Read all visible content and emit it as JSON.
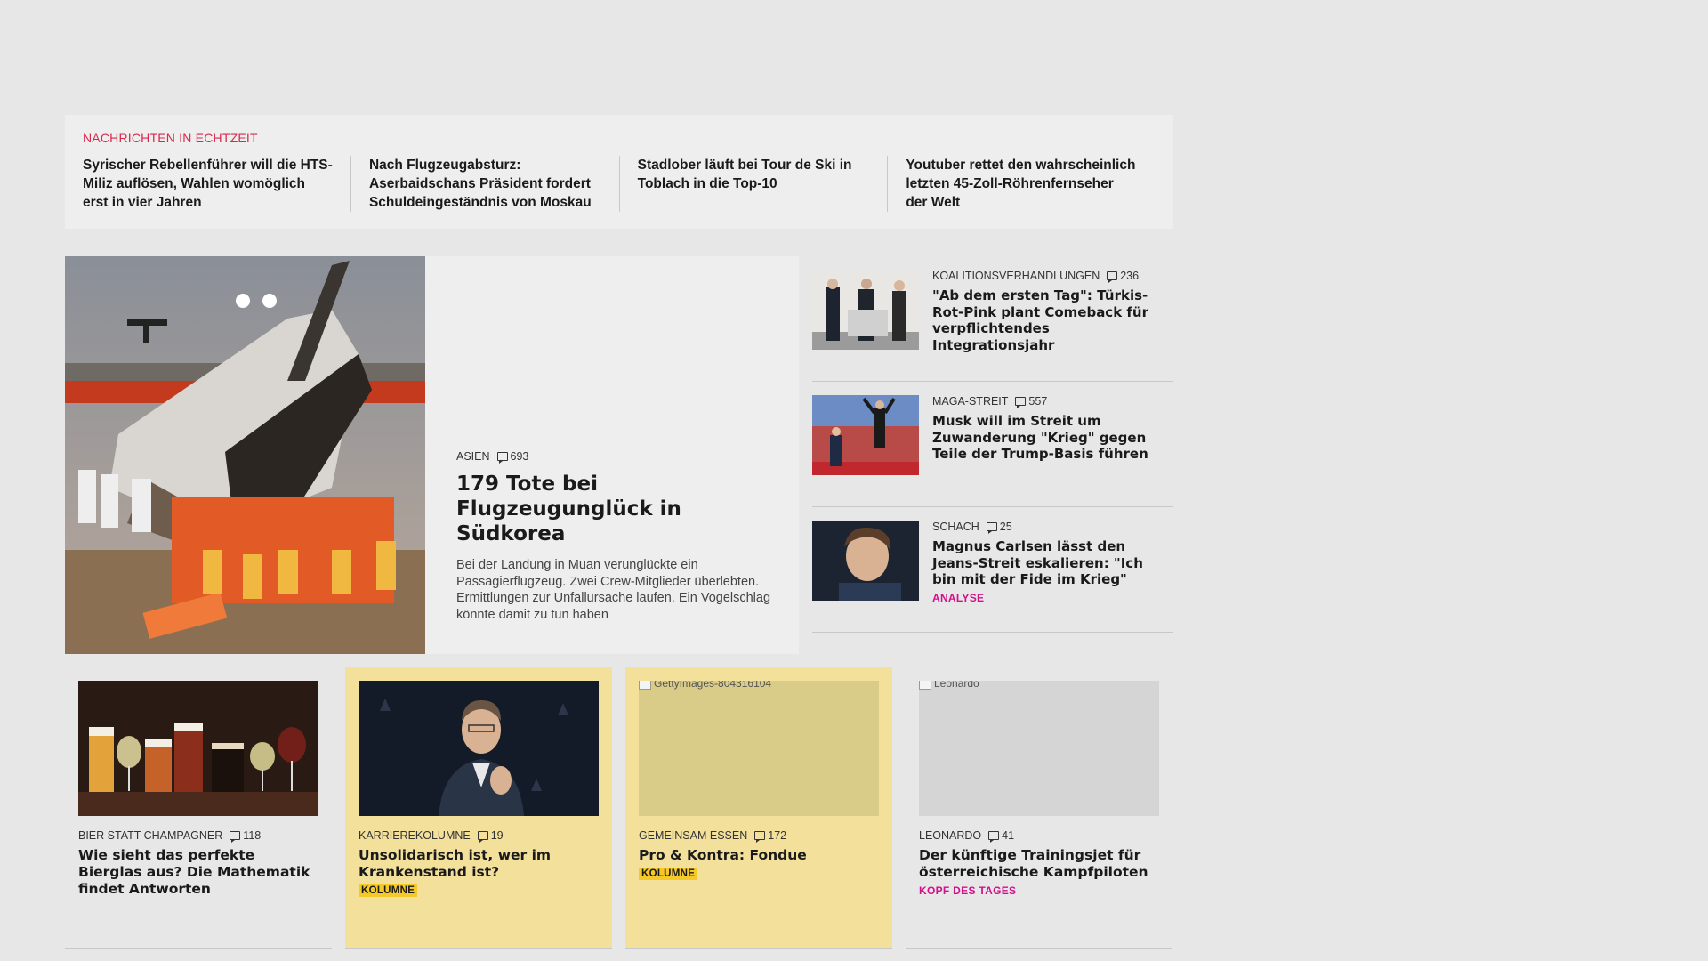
{
  "ticker": {
    "title": "NACHRICHTEN IN ECHTZEIT",
    "items": [
      "Syrischer Rebellenführer will die HTS-Miliz auflösen, Wahlen womöglich erst in vier Jahren",
      "Nach Flugzeugabsturz: Aserbaidschans Präsident fordert Schuldeingeständnis von Moskau",
      "Stadlober läuft bei Tour de Ski in Toblach in die Top-10",
      "Youtuber rettet den wahrscheinlich letzten 45-Zoll-Röhrenfernseher der Welt"
    ]
  },
  "hero": {
    "kicker": "ASIEN",
    "comments": "693",
    "title": "179 Tote bei Flugzeugunglück in Südkorea",
    "lead": "Bei der Landung in Muan verunglückte ein Passagierflugzeug. Zwei Crew-Mitglieder überlebten. Ermittlungen zur Unfallursache laufen. Ein Vogelschlag könnte damit zu tun haben"
  },
  "side": [
    {
      "kicker": "KOALITIONSVERHANDLUNGEN",
      "comments": "236",
      "title": "\"Ab dem ersten Tag\": Türkis-Rot-Pink plant Comeback für verpflichtendes Integrationsjahr",
      "tag": ""
    },
    {
      "kicker": "MAGA-STREIT",
      "comments": "557",
      "title": "Musk will im Streit um Zuwanderung \"Krieg\" gegen Teile der Trump-Basis führen",
      "tag": ""
    },
    {
      "kicker": "SCHACH",
      "comments": "25",
      "title": "Magnus Carlsen lässt den Jeans-Streit eskalieren: \"Ich bin mit der Fide im Krieg\"",
      "tag": "ANALYSE"
    }
  ],
  "cards": [
    {
      "kicker": "BIER STATT CHAMPAGNER",
      "comments": "118",
      "title": "Wie sieht das perfekte Bierglas aus? Die Mathematik findet Antworten",
      "tag": "",
      "alt": ""
    },
    {
      "kicker": "KARRIEREKOLUMNE",
      "comments": "19",
      "title": "Unsolidarisch ist, wer im Krankenstand ist?",
      "tag": "KOLUMNE",
      "alt": ""
    },
    {
      "kicker": "GEMEINSAM ESSEN",
      "comments": "172",
      "title": "Pro & Kontra: Fondue",
      "tag": "KOLUMNE",
      "alt": "GettyImages-804316104"
    },
    {
      "kicker": "LEONARDO",
      "comments": "41",
      "title": "Der künftige Trainingsjet für österreichische Kampfpiloten",
      "tag": "KOPF DES TAGES",
      "alt": "Leonardo"
    }
  ],
  "colors": {
    "ticker_title": "#d8294d",
    "pink_tag": "#d1118a",
    "yellow_card": "#f3e09b",
    "yellow_tag": "#f5c929"
  }
}
